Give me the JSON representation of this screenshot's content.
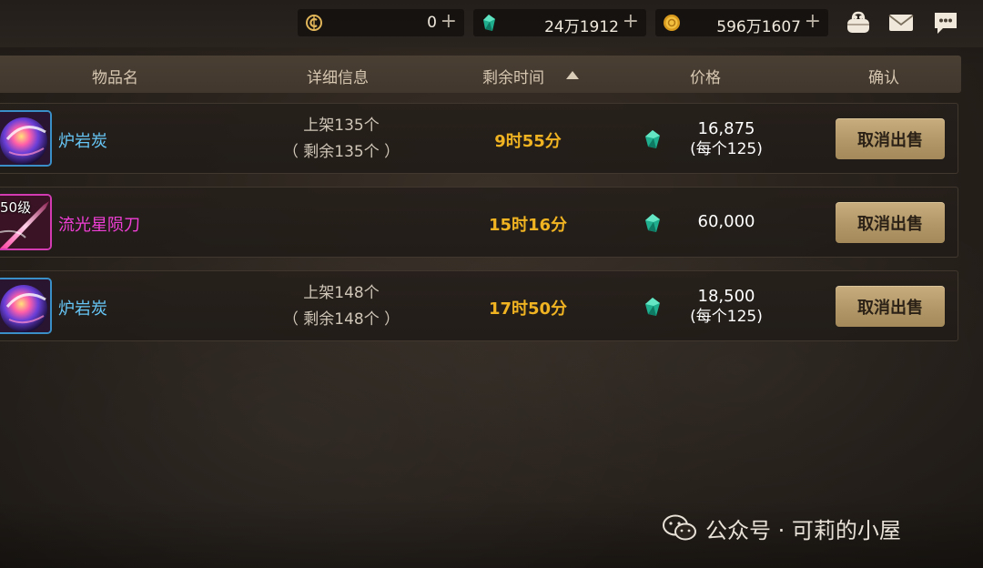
{
  "currencies": [
    {
      "icon": "c-coin-icon",
      "value": "0"
    },
    {
      "icon": "green-gem-icon",
      "value": "24万1912"
    },
    {
      "icon": "gold-coin-icon",
      "value": "596万1607"
    }
  ],
  "plus_symbol": "+",
  "header": {
    "name": "物品名",
    "detail": "详细信息",
    "time": "剩余时间",
    "price": "价格",
    "confirm": "确认"
  },
  "listings": [
    {
      "name": "炉岩炭",
      "detail_line1": "上架135个",
      "detail_line2": "（ 剩余135个 ）",
      "time": "9时55分",
      "price": "16,875",
      "per_unit": "(每个125)",
      "button": "取消出售"
    },
    {
      "name": "流光星陨刀",
      "level": "50级",
      "time": "15时16分",
      "price": "60,000",
      "button": "取消出售"
    },
    {
      "name": "炉岩炭",
      "detail_line1": "上架148个",
      "detail_line2": "（ 剩余148个 ）",
      "time": "17时50分",
      "price": "18,500",
      "per_unit": "(每个125)",
      "button": "取消出售"
    }
  ],
  "watermark": "公众号 · 可莉的小屋",
  "colors": {
    "time": "#f0b321",
    "item_blue": "#66c5f5",
    "item_pink": "#f03fd6",
    "button": "#b29868"
  }
}
